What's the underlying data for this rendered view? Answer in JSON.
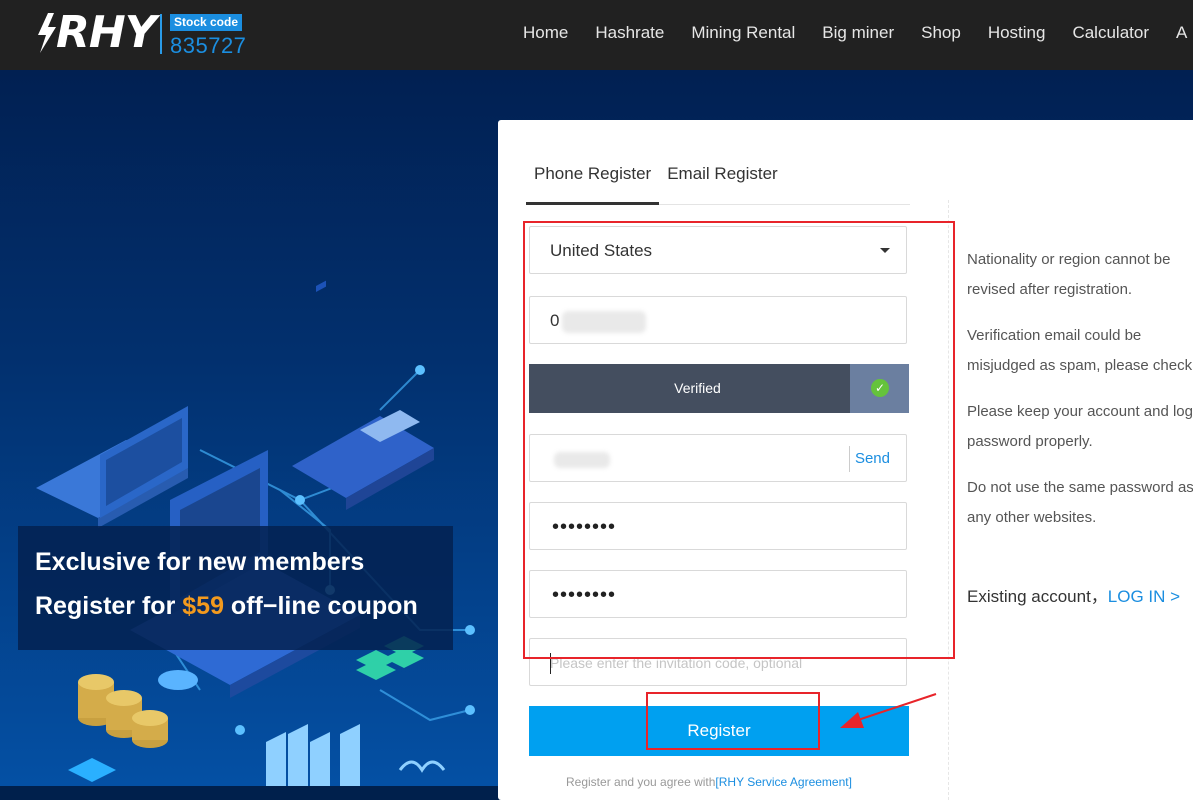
{
  "header": {
    "logo_text": "RHY",
    "stock_label": "Stock code",
    "stock_code": "835727",
    "nav": [
      "Home",
      "Hashrate",
      "Mining Rental",
      "Big miner",
      "Shop",
      "Hosting",
      "Calculator",
      "A"
    ]
  },
  "promo": {
    "line1": "Exclusive for new members",
    "line2_prefix": "Register for ",
    "line2_amount": "$59",
    "line2_suffix": " off−line coupon"
  },
  "form": {
    "tabs": [
      {
        "label": "Phone Register",
        "active": true
      },
      {
        "label": "Email Register",
        "active": false
      }
    ],
    "country": "United States",
    "phone_prefix": "0",
    "verify_label": "Verified",
    "send_label": "Send",
    "password_mask": "••••••••",
    "confirm_mask": "••••••••",
    "invite_placeholder": "Please enter the invitation code, optional",
    "register_label": "Register",
    "agree_text": "Register and you agree with",
    "agree_link": "[RHY Service Agreement]"
  },
  "tips": [
    "Nationality or region cannot be revised after registration.",
    "Verification email could be misjudged as spam, please check.",
    "Please keep your account and login password properly.",
    "Do not use the same password as any other websites."
  ],
  "login": {
    "text": "Existing account，",
    "link": "LOG IN >"
  },
  "colors": {
    "accent": "#00a0f0",
    "link": "#1b8ee0",
    "annotation": "#e8242a",
    "coupon": "#f39a1e"
  }
}
